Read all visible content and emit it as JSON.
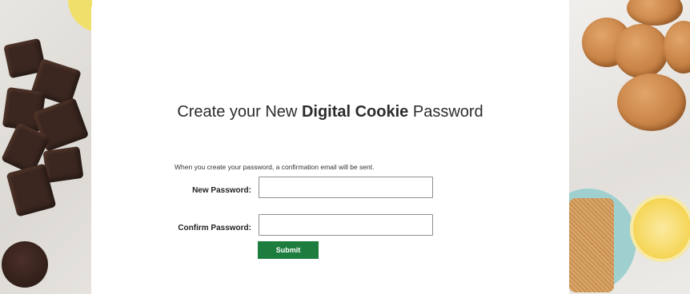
{
  "form": {
    "title_prefix": "Create your New ",
    "title_bold": "Digital Cookie",
    "title_suffix": " Password",
    "confirmation_note": "When you create your password, a confirmation email will be sent.",
    "new_password_label": "New Password:",
    "new_password_value": "",
    "confirm_password_label": "Confirm Password:",
    "confirm_password_value": "",
    "submit_label": "Submit"
  },
  "colors": {
    "submit_button": "#1c7d3e",
    "card_background": "#ffffff"
  }
}
